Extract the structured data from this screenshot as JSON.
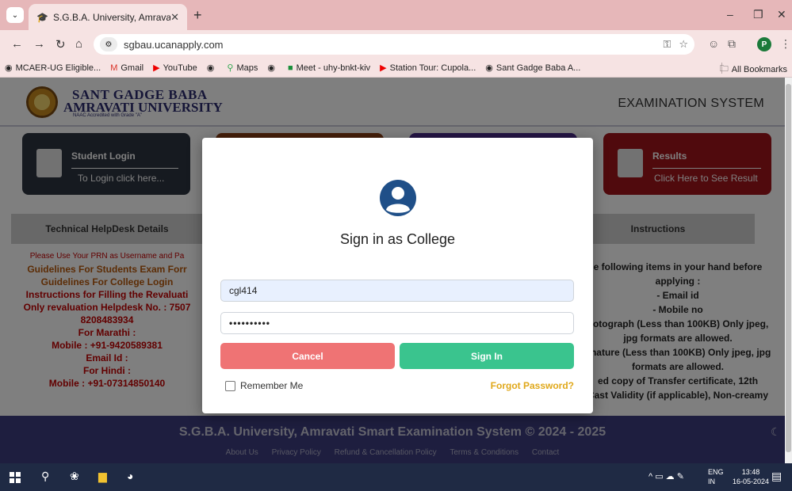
{
  "browser": {
    "tab_title": "S.G.B.A. University, Amravati",
    "url": "sgbau.ucanapply.com",
    "bookmarks": [
      {
        "label": "MCAER-UG Eligible...",
        "icon": "globe-icon"
      },
      {
        "label": "Gmail",
        "icon": "gmail-icon"
      },
      {
        "label": "YouTube",
        "icon": "youtube-icon"
      },
      {
        "label": "",
        "icon": "globe-icon"
      },
      {
        "label": "Maps",
        "icon": "maps-icon"
      },
      {
        "label": "",
        "icon": "globe-icon"
      },
      {
        "label": "Meet - uhy-bnkt-kiv",
        "icon": "meet-icon"
      },
      {
        "label": "Station Tour: Cupola...",
        "icon": "youtube-icon"
      },
      {
        "label": "Sant Gadge Baba A...",
        "icon": "globe-icon"
      }
    ],
    "all_bookmarks": "All Bookmarks",
    "profile_initial": "P"
  },
  "site": {
    "logo_line1": "SANT GADGE BABA",
    "logo_line2": "AMRAVATI UNIVERSITY",
    "logo_line3": "NAAC Accredited with Grade \"A\"",
    "system_title": "EXAMINATION SYSTEM",
    "cards": [
      {
        "title": "Student Login",
        "subtitle": "To Login click here...",
        "color": "#2d3440"
      },
      {
        "title": "",
        "subtitle": "",
        "color": "#8b3d12"
      },
      {
        "title": "",
        "subtitle": "",
        "color": "#4a2a8a"
      },
      {
        "title": "Results",
        "subtitle": "Click Here to See Result",
        "color": "#a0141a"
      }
    ],
    "help_heading": "Technical HelpDesk Details",
    "instructions_heading": "Instructions",
    "help_lines": {
      "note": "Please Use Your PRN as Username and Pa",
      "link1": "Guidelines For Students Exam Forr",
      "link2": "Guidelines For College Login",
      "link3": "Instructions for Filling the Revaluati",
      "reval": "Only revaluation Helpdesk No. : 7507",
      "reval_no": "8208483934",
      "marathi": "For Marathi :",
      "marathi_mobile": "Mobile : +91-9420589381",
      "email": "Email Id :",
      "hindi": "For Hindi :",
      "hindi_mobile": "Mobile : +91-07314850140"
    },
    "instruction_lines": [
      "e following items in your hand before",
      "applying :",
      "- Email id",
      "- Mobile no",
      "hotograph (Less than 100KB) Only jpeg,",
      "jpg formats are allowed.",
      "gnature (Less than 100KB) Only jpeg, jpg",
      "formats are allowed.",
      "ed copy of Transfer certificate, 12th",
      "Cast Validity (if applicable), Non-creamy"
    ],
    "footer_copy": "S.G.B.A. University, Amravati Smart Examination System © 2024 - 2025",
    "footer_links": [
      "About Us",
      "Privacy Policy",
      "Refund & Cancellation Policy",
      "Terms & Conditions",
      "Contact"
    ]
  },
  "modal": {
    "title": "Sign in as College",
    "username_value": "cgl414",
    "password_value": "••••••••••",
    "cancel_label": "Cancel",
    "signin_label": "Sign In",
    "remember_label": "Remember Me",
    "forgot_label": "Forgot Password?"
  },
  "taskbar": {
    "lang_line1": "ENG",
    "lang_line2": "IN",
    "time": "13:48",
    "date": "16-05-2024"
  }
}
